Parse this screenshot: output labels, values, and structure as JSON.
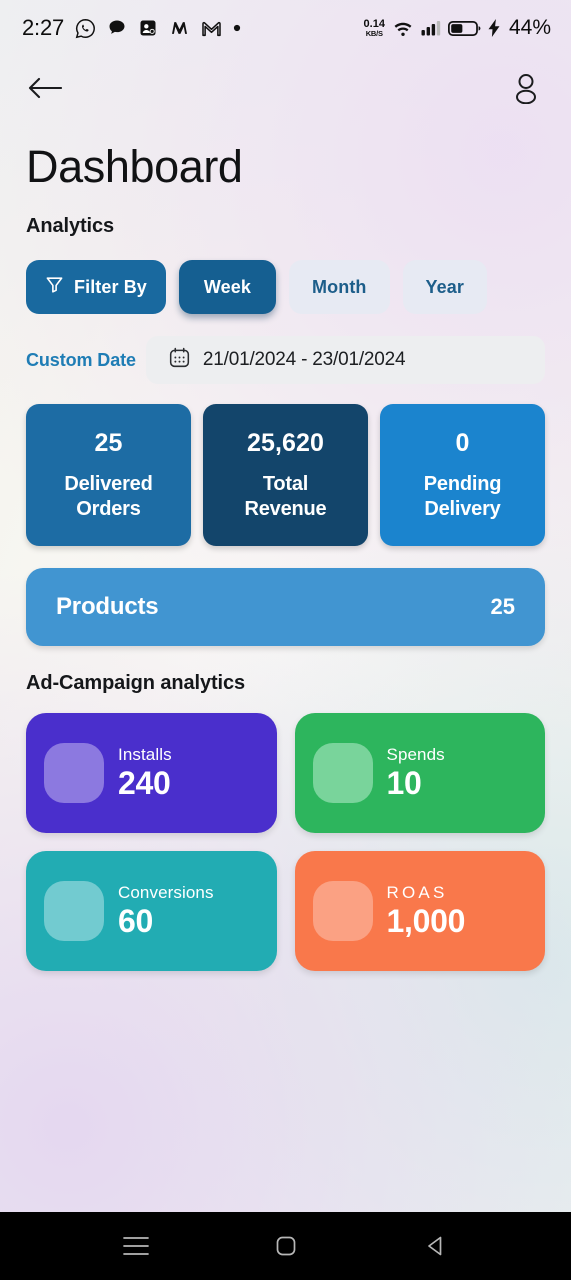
{
  "status_bar": {
    "time": "2:27",
    "icons": [
      "whatsapp-icon",
      "chat-bubble-icon",
      "contacts-app-icon",
      "m-app-icon",
      "gmail-icon",
      "dot-icon"
    ],
    "net_speed_value": "0.14",
    "net_speed_unit": "KB/S",
    "right_icons": [
      "wifi-icon",
      "cellular-signal-icon",
      "battery-icon",
      "charging-bolt-icon"
    ],
    "battery_percent": "44%"
  },
  "appbar": {
    "back_icon": "back-arrow-icon",
    "profile_icon": "person-icon"
  },
  "header": {
    "title": "Dashboard",
    "section": "Analytics"
  },
  "filters": {
    "filter_by_label": "Filter By",
    "filter_icon": "funnel-icon",
    "options": [
      {
        "label": "Week",
        "selected": true
      },
      {
        "label": "Month",
        "selected": false
      },
      {
        "label": "Year",
        "selected": false
      }
    ]
  },
  "custom_date": {
    "label": "Custom Date",
    "calendar_icon": "calendar-icon",
    "value": "21/01/2024 - 23/01/2024"
  },
  "stats": [
    {
      "value": "25",
      "label": "Delivered\nOrders",
      "label_line1": "Delivered",
      "label_line2": "Orders",
      "color": "#1D6CA4"
    },
    {
      "value": "25,620",
      "label_line1": "Total",
      "label_line2": "Revenue",
      "color": "#13456B"
    },
    {
      "value": "0",
      "label_line1": "Pending",
      "label_line2": "Delivery",
      "color": "#1B84CE"
    }
  ],
  "products": {
    "label": "Products",
    "value": "25",
    "color": "#4195D1"
  },
  "campaign": {
    "section_title": "Ad-Campaign analytics",
    "cards": [
      {
        "label": "Installs",
        "value": "240",
        "color": "#4A2FCC",
        "thumb_color": "#8C79E0",
        "spaced": false
      },
      {
        "label": "Spends",
        "value": "10",
        "color": "#2DB55D",
        "thumb_color": "#79D49B",
        "spaced": false
      },
      {
        "label": "Conversions",
        "value": "60",
        "color": "#22ACB3",
        "thumb_color": "#72CBD0",
        "spaced": false
      },
      {
        "label": "ROAS",
        "value": "1,000",
        "color": "#F9784B",
        "thumb_color": "#FBA183",
        "spaced": true
      }
    ]
  },
  "navbar": {
    "recents_icon": "recents-menu-icon",
    "home_icon": "home-square-icon",
    "back_icon": "back-triangle-icon"
  }
}
